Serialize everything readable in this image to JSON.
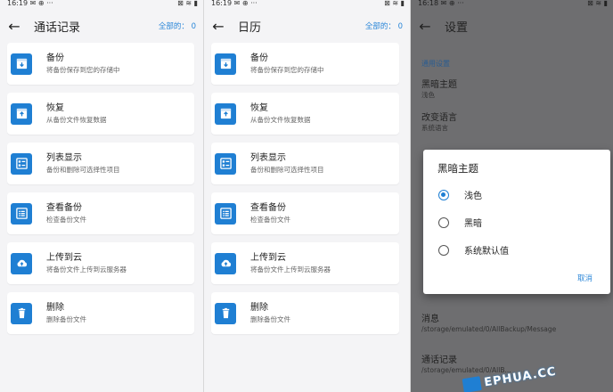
{
  "status_bar": {
    "time_left": "16:19",
    "time_mid": "16:19",
    "time_right": "16:18",
    "icons": "✉ ⊕ ···",
    "right_icons": "⊠ ≋ ▮"
  },
  "panels": [
    {
      "title": "通话记录",
      "select_all": "全部的： 0",
      "items": [
        {
          "icon": "archive-icon",
          "title": "备份",
          "subtitle": "将备份保存到您的存储中"
        },
        {
          "icon": "restore-icon",
          "title": "恢复",
          "subtitle": "从备份文件恢复数据"
        },
        {
          "icon": "list-icon",
          "title": "列表显示",
          "subtitle": "备份和删除可选择性项目"
        },
        {
          "icon": "view-list-icon",
          "title": "查看备份",
          "subtitle": "检查备份文件"
        },
        {
          "icon": "cloud-upload-icon",
          "title": "上传到云",
          "subtitle": "将备份文件上传到云服务器"
        },
        {
          "icon": "trash-icon",
          "title": "删除",
          "subtitle": "删除备份文件"
        }
      ]
    },
    {
      "title": "日历",
      "select_all": "全部的： 0",
      "items": [
        {
          "icon": "archive-icon",
          "title": "备份",
          "subtitle": "将备份保存到您的存储中"
        },
        {
          "icon": "restore-icon",
          "title": "恢复",
          "subtitle": "从备份文件恢复数据"
        },
        {
          "icon": "list-icon",
          "title": "列表显示",
          "subtitle": "备份和删除可选择性项目"
        },
        {
          "icon": "view-list-icon",
          "title": "查看备份",
          "subtitle": "检查备份文件"
        },
        {
          "icon": "cloud-upload-icon",
          "title": "上传到云",
          "subtitle": "将备份文件上传到云服务器"
        },
        {
          "icon": "trash-icon",
          "title": "删除",
          "subtitle": "删除备份文件"
        }
      ]
    }
  ],
  "settings": {
    "title": "设置",
    "section": "通用设置",
    "prefs": [
      {
        "title": "黑暗主题",
        "summary": "浅色"
      },
      {
        "title": "改变语言",
        "summary": "系统语言"
      }
    ],
    "bottom_prefs": [
      {
        "title": "消息",
        "summary": "/storage/emulated/0/AllBackup/Message"
      },
      {
        "title": "通话记录",
        "summary": "/storage/emulated/0/AllB..."
      }
    ]
  },
  "dialog": {
    "title": "黑暗主题",
    "options": [
      {
        "label": "浅色",
        "selected": true
      },
      {
        "label": "黑暗",
        "selected": false
      },
      {
        "label": "系统默认值",
        "selected": false
      }
    ],
    "cancel": "取消"
  },
  "watermark": {
    "text": "EPHUA.CC"
  },
  "colors": {
    "accent": "#1f7fd3",
    "link": "#2a86d8",
    "panel_bg": "#f4f4f6",
    "scrim": "#6e6e70"
  }
}
